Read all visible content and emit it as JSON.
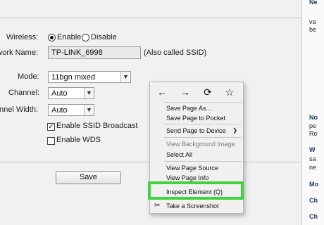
{
  "settings": {
    "wireless_label": "Wireless:",
    "enable_label": "Enable",
    "disable_label": "Disable",
    "network_name_label": "Wireless Network Name:",
    "ssid_value": "TP-LINK_6998",
    "ssid_hint": "(Also called SSID)",
    "mode_label": "Mode:",
    "mode_value": "11bgn mixed",
    "channel_label": "Channel:",
    "channel_value": "Auto",
    "channel_width_label": "Channel Width:",
    "channel_width_value": "Auto",
    "ssid_broadcast_label": "Enable SSID Broadcast",
    "ssid_broadcast_checked": true,
    "wds_label": "Enable WDS",
    "wds_checked": false,
    "save_label": "Save"
  },
  "context_menu": {
    "nav": {
      "back": "←",
      "forward": "→",
      "reload": "⟳",
      "bookmark": "☆"
    },
    "items": [
      {
        "label": "Save Page As..."
      },
      {
        "label": "Save Page to Pocket"
      },
      {
        "label": "Send Page to Device"
      },
      {
        "label": "View Background Image"
      },
      {
        "label": "Select All"
      },
      {
        "label": "View Page Source"
      },
      {
        "label": "View Page Info"
      },
      {
        "label": "Inspect Element (Q)"
      },
      {
        "label": "Take a Screenshot"
      }
    ],
    "highlight_color": "#3ed43e"
  },
  "help_panel": {
    "lines": [
      "Ne",
      "va",
      "be",
      "No",
      "pe",
      "Ro",
      "W",
      "sa",
      "ne",
      "Mo",
      "Ch",
      "Ch"
    ]
  }
}
